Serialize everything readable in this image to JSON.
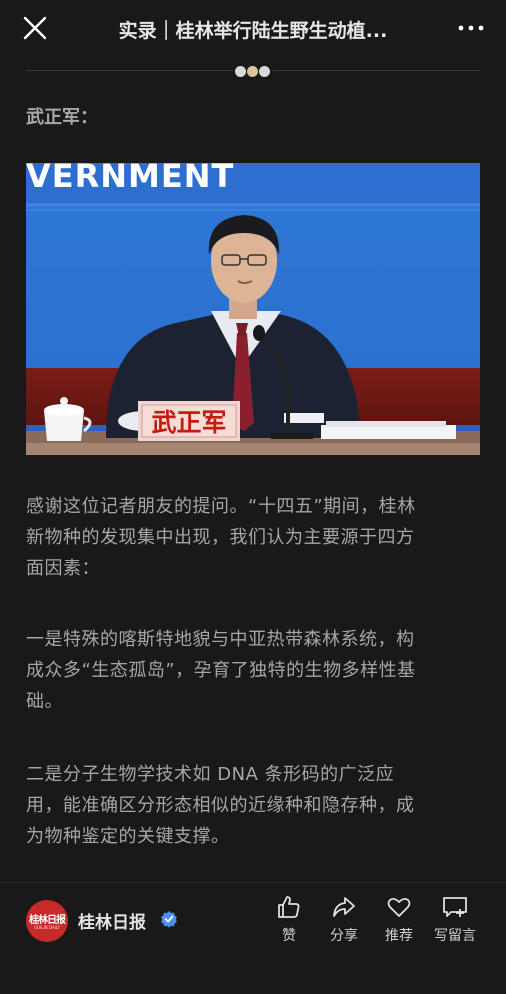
{
  "header": {
    "title": "实录｜桂林举行陆生野生动植..."
  },
  "article": {
    "speaker": "武正军：",
    "photo": {
      "backdrop_text": "VERNMENT",
      "nameplate": "武正军"
    },
    "paragraphs": [
      [
        "感谢这位记者朋友的提问。“十四五”期间，桂林",
        "新物种的发现集中出现，我们认为主要源于四方",
        "面因素："
      ],
      [
        "一是特殊的喀斯特地貌与中亚热带森林系统，构",
        "成众多“生态孤岛”，孕育了独特的生物多样性基",
        "础。"
      ],
      [
        "二是分子生物学技术如 DNA 条形码的广泛应",
        "用，能准确区分形态相似的近缘种和隐存种，成",
        "为物种鉴定的关键支撑。"
      ]
    ]
  },
  "bottom_bar": {
    "account": {
      "logo_text": "桂林日报",
      "logo_subtext": "GUILIN DAILY",
      "name": "桂林日报",
      "verified_icon": "verified-badge-icon"
    },
    "actions": [
      {
        "label": "赞",
        "icon": "thumbs-up-icon"
      },
      {
        "label": "分享",
        "icon": "share-arrow-icon"
      },
      {
        "label": "推荐",
        "icon": "heart-icon"
      },
      {
        "label": "写留言",
        "icon": "comment-plus-icon"
      }
    ]
  },
  "colors": {
    "background": "#191919",
    "text": "#a5a5a5",
    "accent_red": "#c82a2a",
    "verified_blue": "#4a90e8"
  }
}
